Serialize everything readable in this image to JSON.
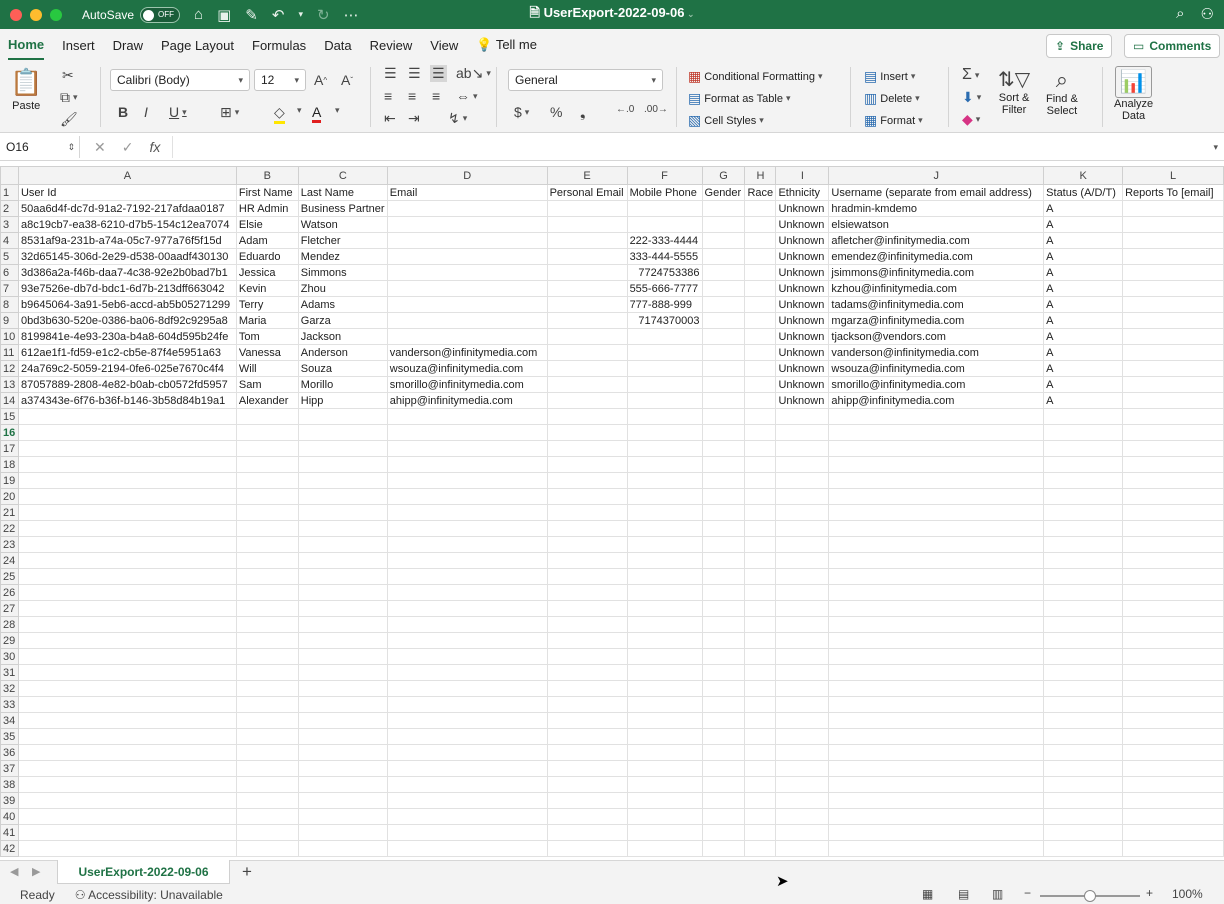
{
  "window": {
    "autosave_label": "AutoSave",
    "autosave_state": "OFF",
    "doc_title": "UserExport-2022-09-06"
  },
  "tabs": [
    "Home",
    "Insert",
    "Draw",
    "Page Layout",
    "Formulas",
    "Data",
    "Review",
    "View",
    "Tell me"
  ],
  "share_label": "Share",
  "comments_label": "Comments",
  "ribbon": {
    "paste": "Paste",
    "font_name": "Calibri (Body)",
    "font_size": "12",
    "number_format": "General",
    "conditional_formatting": "Conditional Formatting",
    "format_as_table": "Format as Table",
    "cell_styles": "Cell Styles",
    "insert": "Insert",
    "delete": "Delete",
    "format": "Format",
    "sort_filter_1": "Sort &",
    "sort_filter_2": "Filter",
    "find_select_1": "Find &",
    "find_select_2": "Select",
    "analyze_1": "Analyze",
    "analyze_2": "Data"
  },
  "formula_bar": {
    "name_box": "O16",
    "formula": ""
  },
  "columns": [
    "A",
    "B",
    "C",
    "D",
    "E",
    "F",
    "G",
    "H",
    "I",
    "J",
    "K",
    "L"
  ],
  "rows": [
    [
      "User Id",
      "First Name",
      "Last Name",
      "Email",
      "Personal Email",
      "Mobile Phone",
      "Gender",
      "Race",
      "Ethnicity",
      "Username (separate from email address)",
      "Status (A/D/T)",
      "Reports To [email]"
    ],
    [
      "50aa6d4f-dc7d-91a2-7192-217afdaa0187",
      "HR Admin",
      "Business Partner",
      "",
      "",
      "",
      "",
      "",
      "Unknown",
      "hradmin-kmdemo",
      "A",
      ""
    ],
    [
      "a8c19cb7-ea38-6210-d7b5-154c12ea7074",
      "Elsie",
      "Watson",
      "",
      "",
      "",
      "",
      "",
      "Unknown",
      "elsiewatson",
      "A",
      ""
    ],
    [
      "8531af9a-231b-a74a-05c7-977a76f5f15d",
      "Adam",
      "Fletcher",
      "",
      "",
      "222-333-4444",
      "",
      "",
      "Unknown",
      "afletcher@infinitymedia.com",
      "A",
      ""
    ],
    [
      "32d65145-306d-2e29-d538-00aadf430130",
      "Eduardo",
      "Mendez",
      "",
      "",
      "333-444-5555",
      "",
      "",
      "Unknown",
      "emendez@infinitymedia.com",
      "A",
      ""
    ],
    [
      "3d386a2a-f46b-daa7-4c38-92e2b0bad7b1",
      "Jessica",
      "Simmons",
      "",
      "",
      "7724753386",
      "",
      "",
      "Unknown",
      "jsimmons@infinitymedia.com",
      "A",
      ""
    ],
    [
      "93e7526e-db7d-bdc1-6d7b-213dff663042",
      "Kevin",
      "Zhou",
      "",
      "",
      "555-666-7777",
      "",
      "",
      "Unknown",
      "kzhou@infinitymedia.com",
      "A",
      ""
    ],
    [
      "b9645064-3a91-5eb6-accd-ab5b05271299",
      "Terry",
      "Adams",
      "",
      "",
      "777-888-999",
      "",
      "",
      "Unknown",
      "tadams@infinitymedia.com",
      "A",
      ""
    ],
    [
      "0bd3b630-520e-0386-ba06-8df92c9295a8",
      "Maria",
      "Garza",
      "",
      "",
      "7174370003",
      "",
      "",
      "Unknown",
      "mgarza@infinitymedia.com",
      "A",
      ""
    ],
    [
      "8199841e-4e93-230a-b4a8-604d595b24fe",
      "Tom",
      "Jackson",
      "",
      "",
      "",
      "",
      "",
      "Unknown",
      "tjackson@vendors.com",
      "A",
      ""
    ],
    [
      "612ae1f1-fd59-e1c2-cb5e-87f4e5951a63",
      "Vanessa",
      "Anderson",
      "vanderson@infinitymedia.com",
      "",
      "",
      "",
      "",
      "Unknown",
      "vanderson@infinitymedia.com",
      "A",
      ""
    ],
    [
      "24a769c2-5059-2194-0fe6-025e7670c4f4",
      "Will",
      "Souza",
      "wsouza@infinitymedia.com",
      "",
      "",
      "",
      "",
      "Unknown",
      "wsouza@infinitymedia.com",
      "A",
      ""
    ],
    [
      "87057889-2808-4e82-b0ab-cb0572fd5957",
      "Sam",
      "Morillo",
      "smorillo@infinitymedia.com",
      "",
      "",
      "",
      "",
      "Unknown",
      "smorillo@infinitymedia.com",
      "A",
      ""
    ],
    [
      "a374343e-6f76-b36f-b146-3b58d84b19a1",
      "Alexander",
      "Hipp",
      "ahipp@infinitymedia.com",
      "",
      "",
      "",
      "",
      "Unknown",
      "ahipp@infinitymedia.com",
      "A",
      ""
    ]
  ],
  "total_rows": 42,
  "selected_row": 16,
  "sheet_tab": "UserExport-2022-09-06",
  "status": {
    "ready": "Ready",
    "accessibility": "Accessibility: Unavailable",
    "zoom": "100%"
  }
}
